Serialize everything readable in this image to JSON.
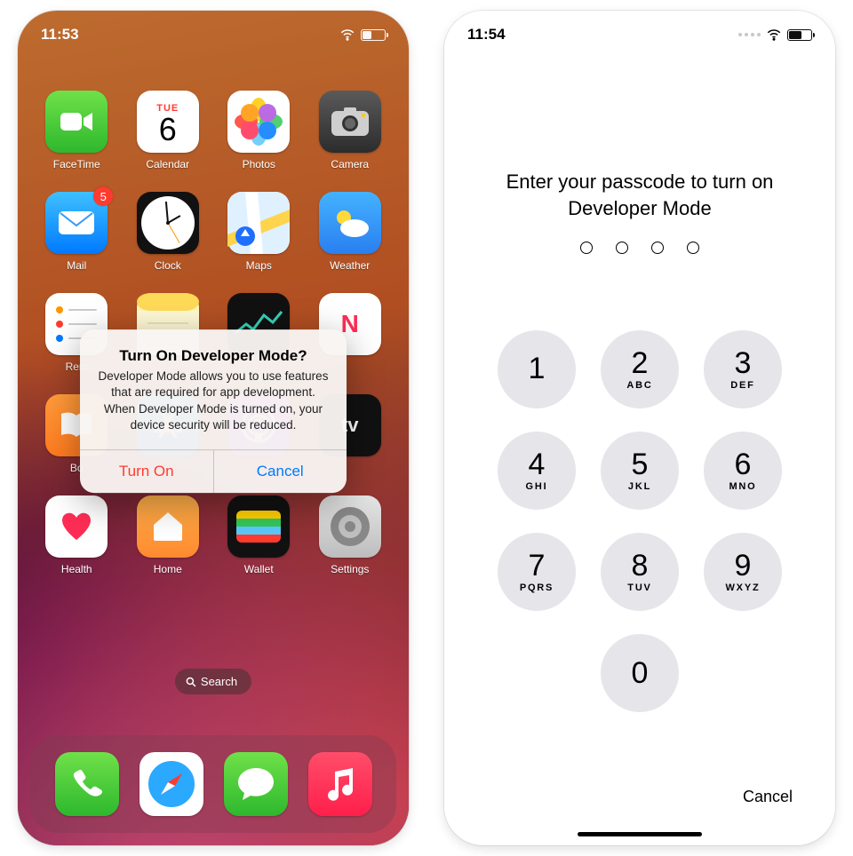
{
  "left": {
    "status": {
      "time": "11:53"
    },
    "calendar": {
      "dow": "TUE",
      "dom": "6"
    },
    "badge_mail": "5",
    "tv_text": "tv",
    "news_text": "N",
    "apps": {
      "facetime": "FaceTime",
      "calendar": "Calendar",
      "photos": "Photos",
      "camera": "Camera",
      "mail": "Mail",
      "clock": "Clock",
      "maps": "Maps",
      "weather": "Weather",
      "reminders": "Rem",
      "notes": "",
      "stocks": "",
      "news": "",
      "books": "Bo",
      "store": "",
      "podcasts": "",
      "tv": "",
      "health": "Health",
      "home": "Home",
      "wallet": "Wallet",
      "settings": "Settings"
    },
    "search_label": "Search",
    "alert": {
      "title": "Turn On Developer Mode?",
      "message": "Developer Mode allows you to use features that are required for app development. When Developer Mode is turned on, your device security will be reduced.",
      "turn_on": "Turn On",
      "cancel": "Cancel"
    }
  },
  "right": {
    "status": {
      "time": "11:54"
    },
    "title": "Enter your passcode to turn on Developer Mode",
    "keys": [
      {
        "n": "1",
        "l": ""
      },
      {
        "n": "2",
        "l": "ABC"
      },
      {
        "n": "3",
        "l": "DEF"
      },
      {
        "n": "4",
        "l": "GHI"
      },
      {
        "n": "5",
        "l": "JKL"
      },
      {
        "n": "6",
        "l": "MNO"
      },
      {
        "n": "7",
        "l": "PQRS"
      },
      {
        "n": "8",
        "l": "TUV"
      },
      {
        "n": "9",
        "l": "WXYZ"
      }
    ],
    "zero": "0",
    "cancel": "Cancel"
  }
}
